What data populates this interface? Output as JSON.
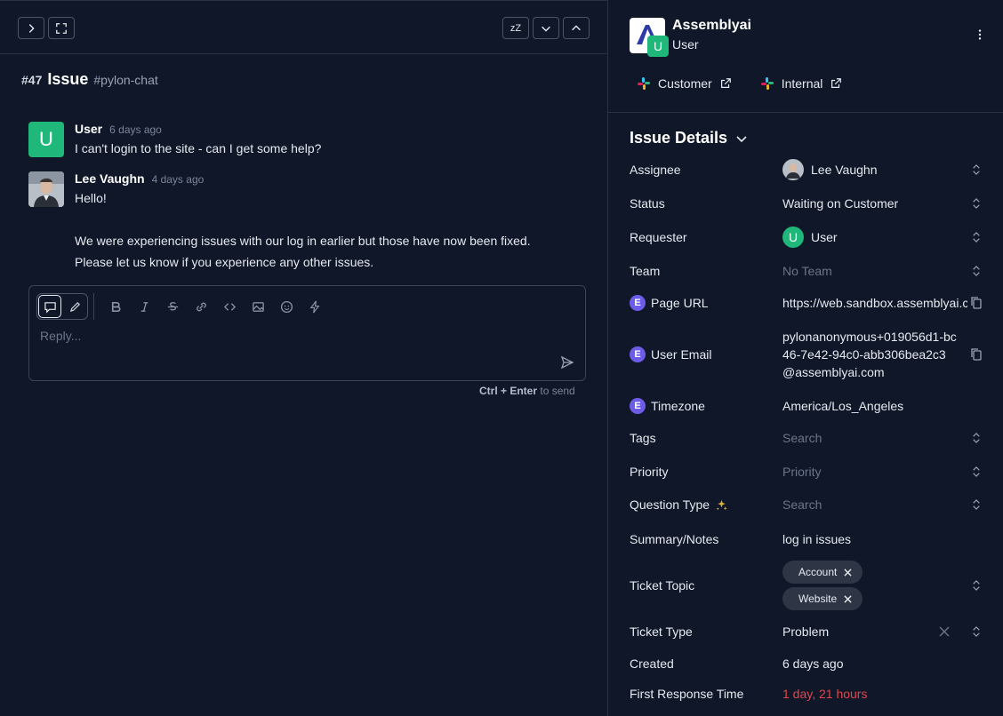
{
  "toolbar": {
    "expand_icon": "chevron-right-icon",
    "fullscreen_icon": "fullscreen-icon",
    "snooze_label": "zZ",
    "down_icon": "chevron-down-icon",
    "up_icon": "chevron-up-icon"
  },
  "issue": {
    "number": "#47",
    "title": "Issue",
    "channel": "#pylon-chat"
  },
  "messages": [
    {
      "avatar_letter": "U",
      "name": "User",
      "time": "6 days ago",
      "lines": [
        "I can't login to the site - can I get some help?"
      ]
    },
    {
      "name": "Lee Vaughn",
      "time": "4 days ago",
      "lines": [
        "Hello!",
        "We were experiencing issues with our log in earlier but those have now been fixed.",
        "Please let us know if you experience any other issues."
      ]
    }
  ],
  "composer": {
    "placeholder": "Reply...",
    "hint_keys": "Ctrl + Enter",
    "hint_text": "to send"
  },
  "account": {
    "name": "Assemblyai",
    "badge_letter": "U",
    "subtitle": "User",
    "links": [
      {
        "label": "Customer",
        "icon": "slack-icon"
      },
      {
        "label": "Internal",
        "icon": "slack-icon"
      }
    ]
  },
  "details": {
    "title": "Issue Details",
    "assignee": {
      "label": "Assignee",
      "value": "Lee Vaughn"
    },
    "status": {
      "label": "Status",
      "value": "Waiting on Customer"
    },
    "requester": {
      "label": "Requester",
      "value": "User",
      "avatar_letter": "U"
    },
    "team": {
      "label": "Team",
      "value": "No Team"
    },
    "page_url": {
      "label": "Page URL",
      "value": "https://web.sandbox.assemblyai.com",
      "badge": "E"
    },
    "user_email": {
      "label": "User Email",
      "value": "pylonanonymous+019056d1-bc46-7e42-94c0-abb306bea2c3@assemblyai.com",
      "badge": "E"
    },
    "timezone": {
      "label": "Timezone",
      "value": "America/Los_Angeles",
      "badge": "E"
    },
    "tags": {
      "label": "Tags",
      "placeholder": "Search"
    },
    "priority": {
      "label": "Priority",
      "placeholder": "Priority"
    },
    "question_type": {
      "label": "Question Type",
      "placeholder": "Search"
    },
    "summary": {
      "label": "Summary/Notes",
      "value": "log in issues"
    },
    "ticket_topic": {
      "label": "Ticket Topic",
      "chips": [
        "Account",
        "Website"
      ]
    },
    "ticket_type": {
      "label": "Ticket Type",
      "value": "Problem"
    },
    "created": {
      "label": "Created",
      "value": "6 days ago"
    },
    "first_response": {
      "label": "First Response Time",
      "value": "1 day, 21 hours"
    }
  },
  "colors": {
    "background": "#0f1729",
    "accent_green": "#1fb87a",
    "badge_purple": "#6d5ce8",
    "warning_red": "#e0474c"
  }
}
